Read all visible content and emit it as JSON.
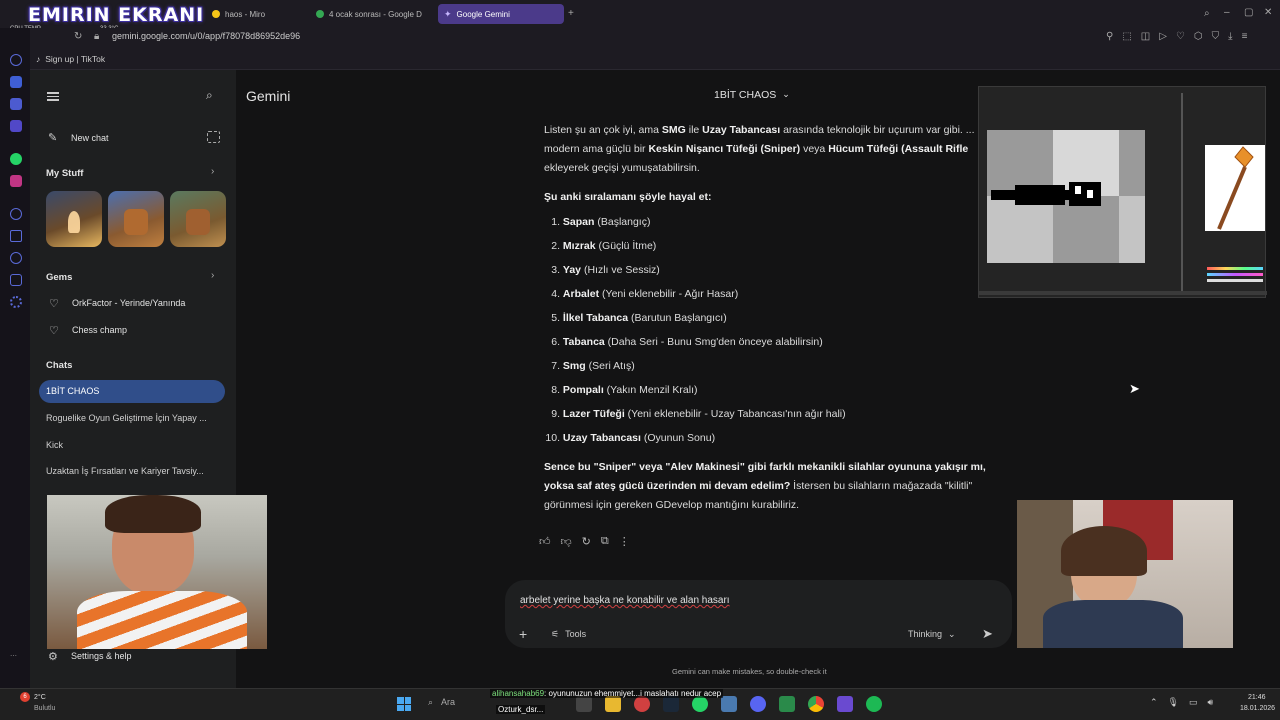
{
  "overlay": {
    "title": "EMIRIN EKRANI",
    "cpu_label": "CPU TEMP",
    "cpu_value": "33.3°C"
  },
  "browser": {
    "tabs": [
      {
        "label": "haos - Miro",
        "color": "#f5c518"
      },
      {
        "label": "4 ocak sonrası - Google D",
        "color": "#34a853"
      },
      {
        "label": "Google Gemini",
        "color": "#8ab4f8"
      }
    ],
    "url": "gemini.google.com/u/0/app/f78078d86952de96",
    "bookmark": "Sign up | TikTok"
  },
  "sidebar": {
    "new_chat": "New chat",
    "my_stuff": "My Stuff",
    "gems_header": "Gems",
    "gems": [
      "OrkFactor - Yerinde/Yanında",
      "Chess champ"
    ],
    "chats_header": "Chats",
    "chats": [
      "1BİT CHAOS",
      "Roguelike Oyun Geliştirme İçin Yapay ...",
      "Kick",
      "Uzaktan İş Fırsatları ve Kariyer Tavsiy..."
    ],
    "settings": "Settings & help"
  },
  "header": {
    "app_name": "Gemini",
    "chat_title": "1BİT CHAOS"
  },
  "response": {
    "intro": {
      "l1a": "Listen şu an çok iyi, ama ",
      "l1b": "SMG",
      "l1c": " ile ",
      "l1d": "Uzay Tabancası",
      "l1e": " arasında teknolojik bir uçurum var gibi. ...",
      "l2a": "modern ama güçlü bir ",
      "l2b": "Keskin Nişancı Tüfeği (Sniper)",
      "l2c": " veya ",
      "l2d": "Hücum Tüfeği (Assault Rifle",
      "l3": "ekleyerek geçişi yumuşatabilirsin."
    },
    "list_heading": "Şu anki sıralamanı şöyle hayal et:",
    "list": [
      {
        "n": "1.",
        "name": "Sapan",
        "desc": " (Başlangıç)"
      },
      {
        "n": "2.",
        "name": "Mızrak",
        "desc": " (Güçlü İtme)"
      },
      {
        "n": "3.",
        "name": "Yay",
        "desc": " (Hızlı ve Sessiz)"
      },
      {
        "n": "4.",
        "name": "Arbalet",
        "desc": " (Yeni eklenebilir - Ağır Hasar)"
      },
      {
        "n": "5.",
        "name": "İlkel Tabanca",
        "desc": " (Barutun Başlangıcı)"
      },
      {
        "n": "6.",
        "name": "Tabanca",
        "desc": " (Daha Seri - Bunu Smg'den önceye alabilirsin)"
      },
      {
        "n": "7.",
        "name": "Smg",
        "desc": " (Seri Atış)"
      },
      {
        "n": "8.",
        "name": "Pompalı",
        "desc": " (Yakın Menzil Kralı)"
      },
      {
        "n": "9.",
        "name": "Lazer Tüfeği",
        "desc": " (Yeni eklenebilir - Uzay Tabancası'nın ağır hali)"
      },
      {
        "n": "10.",
        "name": "Uzay Tabancası",
        "desc": " (Oyunun Sonu)"
      }
    ],
    "outro": {
      "l1": "Sence bu \"Sniper\" veya \"Alev Makinesi\" gibi farklı mekanikli silahlar oyununa yakışır mı,",
      "l2a": "yoksa saf ateş gücü üzerinden mi devam edelim?",
      "l2b": " İstersen bu silahların mağazada \"kilitli\"",
      "l3": "görünmesi için gereken GDevelop mantığını kurabiliriz."
    }
  },
  "input": {
    "text": "arbelet yerine başka ne konabilir ve alan hasarı",
    "tools": "Tools",
    "mode": "Thinking"
  },
  "disclaimer": "Gemini can make mistakes, so double-check it",
  "taskbar": {
    "weather_temp": "2°C",
    "weather_desc": "Bulutlu",
    "weather_badge": "6",
    "search": "Ara",
    "chat_user": "alihansahab69",
    "chat_msg": ": oyununuzun ehemmiyet...i maslahatı nedur acep",
    "chat_user2": "Ozturk_dsr...",
    "time": "21:46",
    "date": "18.01.2026"
  }
}
